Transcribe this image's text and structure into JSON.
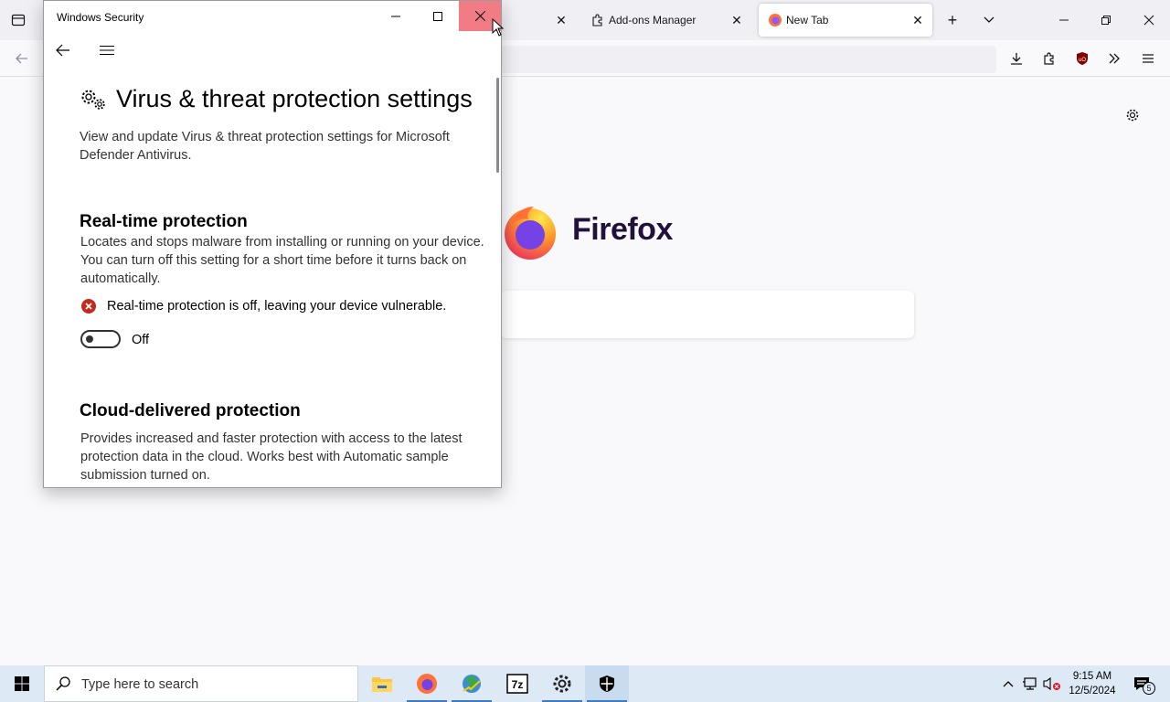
{
  "firefox": {
    "tabs": [
      {
        "label": ""
      },
      {
        "label": "Add-ons Manager"
      },
      {
        "label": "New Tab"
      }
    ],
    "brand": "Firefox"
  },
  "security_window": {
    "title": "Windows Security",
    "page_title": "Virus & threat protection settings",
    "page_description": "View and update Virus & threat protection settings for Microsoft Defender Antivirus.",
    "realtime": {
      "heading": "Real-time protection",
      "description": "Locates and stops malware from installing or running on your device. You can turn off this setting for a short time before it turns back on automatically.",
      "warning": "Real-time protection is off, leaving your device vulnerable.",
      "toggle_label": "Off"
    },
    "cloud": {
      "heading": "Cloud-delivered protection",
      "description": "Provides increased and faster protection with access to the latest protection data in the cloud. Works best with Automatic sample submission turned on."
    },
    "colors": {
      "error": "#c42b1c",
      "close_hover": "#e81123"
    }
  },
  "taskbar": {
    "search_placeholder": "Type here to search",
    "time": "9:15 AM",
    "date": "12/5/2024",
    "notification_count": "5",
    "apps": [
      "file-explorer",
      "firefox",
      "network-app",
      "7zip",
      "settings",
      "windows-security"
    ]
  }
}
